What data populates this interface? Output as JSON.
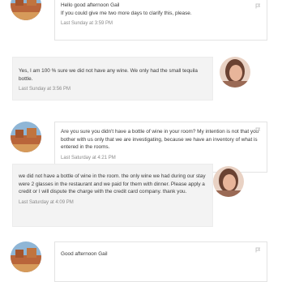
{
  "messages": [
    {
      "text": "Hello good afternoon Gail\nIf you could give me two more days to clarify this, please.",
      "time": "Last Sunday at 3:59 PM",
      "avatar": "desert-landscape-avatar"
    },
    {
      "text": "Yes, I am 100 % sure we did not have any wine. We only had the small tequila bottle.",
      "time": "Last Sunday at 3:56 PM",
      "avatar": "woman-portrait-avatar"
    },
    {
      "text": "Are you sure you didn't have a bottle of wine in your room? My intention is not that you bother with us only that we are investigating, because we have an inventory of what is entered in the rooms.",
      "time": "Last Saturday at 4:21 PM",
      "avatar": "desert-landscape-avatar"
    },
    {
      "text": "we did not have a bottle of wine in the room. the only wine we had during our stay were 2 glasses in the restaurant and we paid for them with dinner. Please apply a credit or I will dispute the charge with the credit card company. thank you.",
      "time": "Last Saturday at 4:09 PM",
      "avatar": "woman-portrait-avatar"
    },
    {
      "text": "Good afternoon Gail",
      "time": "",
      "avatar": "desert-landscape-avatar"
    }
  ],
  "icons": {
    "flag": "flag-icon"
  },
  "colors": {
    "bubble_grey": "#f3f3f3",
    "border": "#e3e3e3",
    "timestamp": "#8a8a8a"
  }
}
